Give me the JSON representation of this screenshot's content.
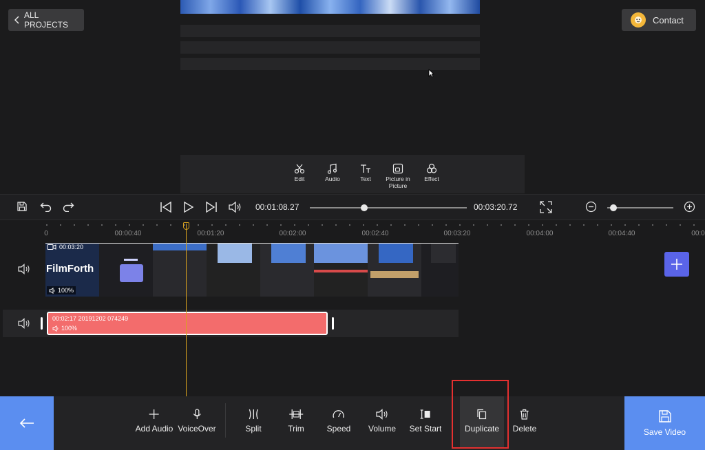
{
  "header": {
    "back_label": "ALL PROJECTS",
    "contact_label": "Contact"
  },
  "edit_tools": [
    {
      "label": "Edit",
      "icon": "scissors-icon"
    },
    {
      "label": "Audio",
      "icon": "music-note-icon"
    },
    {
      "label": "Text",
      "icon": "text-icon"
    },
    {
      "label": "Picture in Picture",
      "icon": "picture-in-picture-icon"
    },
    {
      "label": "Effect",
      "icon": "effect-icon"
    }
  ],
  "player": {
    "current_time": "00:01:08.27",
    "total_time": "00:03:20.72",
    "progress": 0.34
  },
  "timeline": {
    "ticks": [
      "0",
      "00:00:40",
      "00:01:20",
      "00:02:00",
      "00:02:40",
      "00:03:20",
      "00:04:00",
      "00:04:40",
      "00:0"
    ],
    "video_clip": {
      "duration": "00:03:20",
      "volume": "100%",
      "title_overlay": "FilmForth"
    },
    "audio_clip": {
      "meta": "00:02:17   20191202 074249",
      "volume": "100%"
    }
  },
  "actions": [
    {
      "label": "Add Audio",
      "icon": "plus-icon"
    },
    {
      "label": "VoiceOver",
      "icon": "microphone-icon"
    },
    {
      "label": "Split",
      "icon": "split-icon"
    },
    {
      "label": "Trim",
      "icon": "trim-icon"
    },
    {
      "label": "Speed",
      "icon": "speedometer-icon"
    },
    {
      "label": "Volume",
      "icon": "speaker-icon"
    },
    {
      "label": "Set Start",
      "icon": "set-start-icon"
    },
    {
      "label": "Duplicate",
      "icon": "duplicate-icon"
    },
    {
      "label": "Delete",
      "icon": "trash-icon"
    }
  ],
  "save_label": "Save Video",
  "colors": {
    "accent_blue": "#5b8ef0",
    "audio_clip": "#f36c6c",
    "playhead": "#d9a21f",
    "highlight_box": "#e53030"
  }
}
